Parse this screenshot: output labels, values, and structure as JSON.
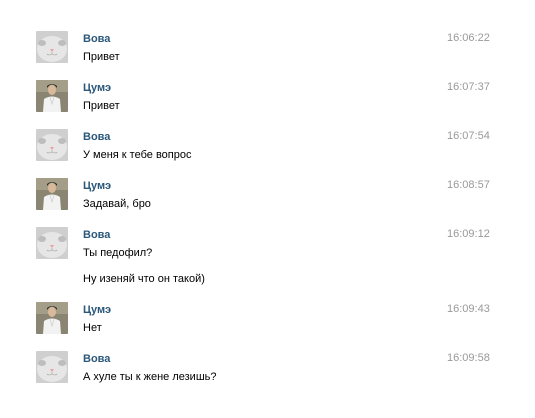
{
  "messages": [
    {
      "author": "Вова",
      "avatar": "cat-avatar",
      "time": "16:06:22",
      "lines": [
        "Привет"
      ]
    },
    {
      "author": "Цумэ",
      "avatar": "man-avatar",
      "time": "16:07:37",
      "lines": [
        "Привет"
      ]
    },
    {
      "author": "Вова",
      "avatar": "cat-avatar",
      "time": "16:07:54",
      "lines": [
        "У меня к тебе вопрос"
      ]
    },
    {
      "author": "Цумэ",
      "avatar": "man-avatar",
      "time": "16:08:57",
      "lines": [
        "Задавай, бро"
      ]
    },
    {
      "author": "Вова",
      "avatar": "cat-avatar",
      "time": "16:09:12",
      "lines": [
        "Ты педофил?",
        "Ну изеняй что он такой)"
      ]
    },
    {
      "author": "Цумэ",
      "avatar": "man-avatar",
      "time": "16:09:43",
      "lines": [
        "Нет"
      ]
    },
    {
      "author": "Вова",
      "avatar": "cat-avatar",
      "time": "16:09:58",
      "lines": [
        "А хуле ты к жене лезишь?"
      ]
    }
  ],
  "colors": {
    "author": "#2b587a",
    "time": "#999999",
    "text": "#000000"
  }
}
